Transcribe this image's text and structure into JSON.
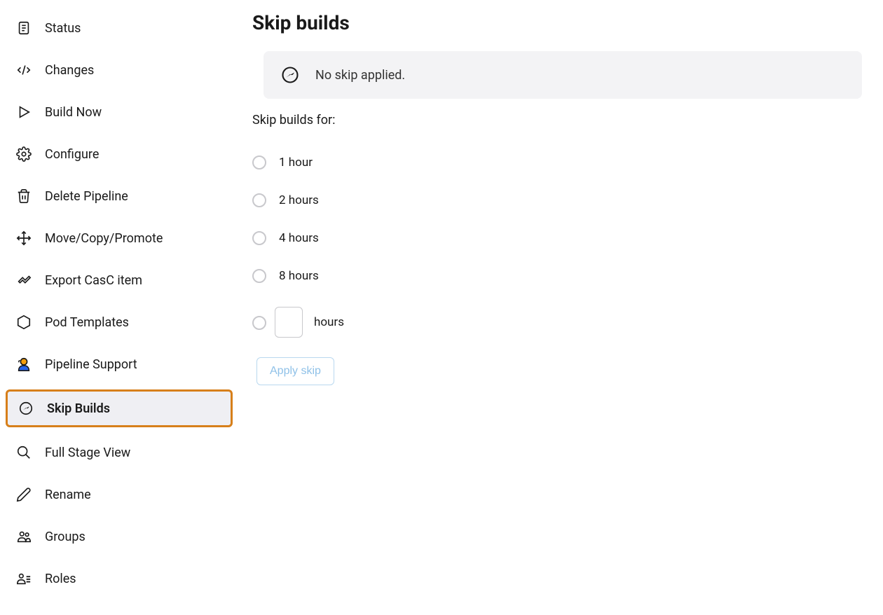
{
  "sidebar": {
    "items": [
      {
        "id": "status",
        "label": "Status"
      },
      {
        "id": "changes",
        "label": "Changes"
      },
      {
        "id": "build-now",
        "label": "Build Now"
      },
      {
        "id": "configure",
        "label": "Configure"
      },
      {
        "id": "delete-pipeline",
        "label": "Delete Pipeline"
      },
      {
        "id": "move-copy-promote",
        "label": "Move/Copy/Promote"
      },
      {
        "id": "export-casc",
        "label": "Export CasC item"
      },
      {
        "id": "pod-templates",
        "label": "Pod Templates"
      },
      {
        "id": "pipeline-support",
        "label": "Pipeline Support"
      },
      {
        "id": "skip-builds",
        "label": "Skip Builds"
      },
      {
        "id": "full-stage-view",
        "label": "Full Stage View"
      },
      {
        "id": "rename",
        "label": "Rename"
      },
      {
        "id": "groups",
        "label": "Groups"
      },
      {
        "id": "roles",
        "label": "Roles"
      }
    ]
  },
  "main": {
    "title": "Skip builds",
    "banner_text": "No skip applied.",
    "section_label": "Skip builds for:",
    "options": [
      {
        "label": "1 hour"
      },
      {
        "label": "2 hours"
      },
      {
        "label": "4 hours"
      },
      {
        "label": "8 hours"
      }
    ],
    "custom_suffix": "hours",
    "custom_value": "",
    "apply_label": "Apply skip"
  }
}
